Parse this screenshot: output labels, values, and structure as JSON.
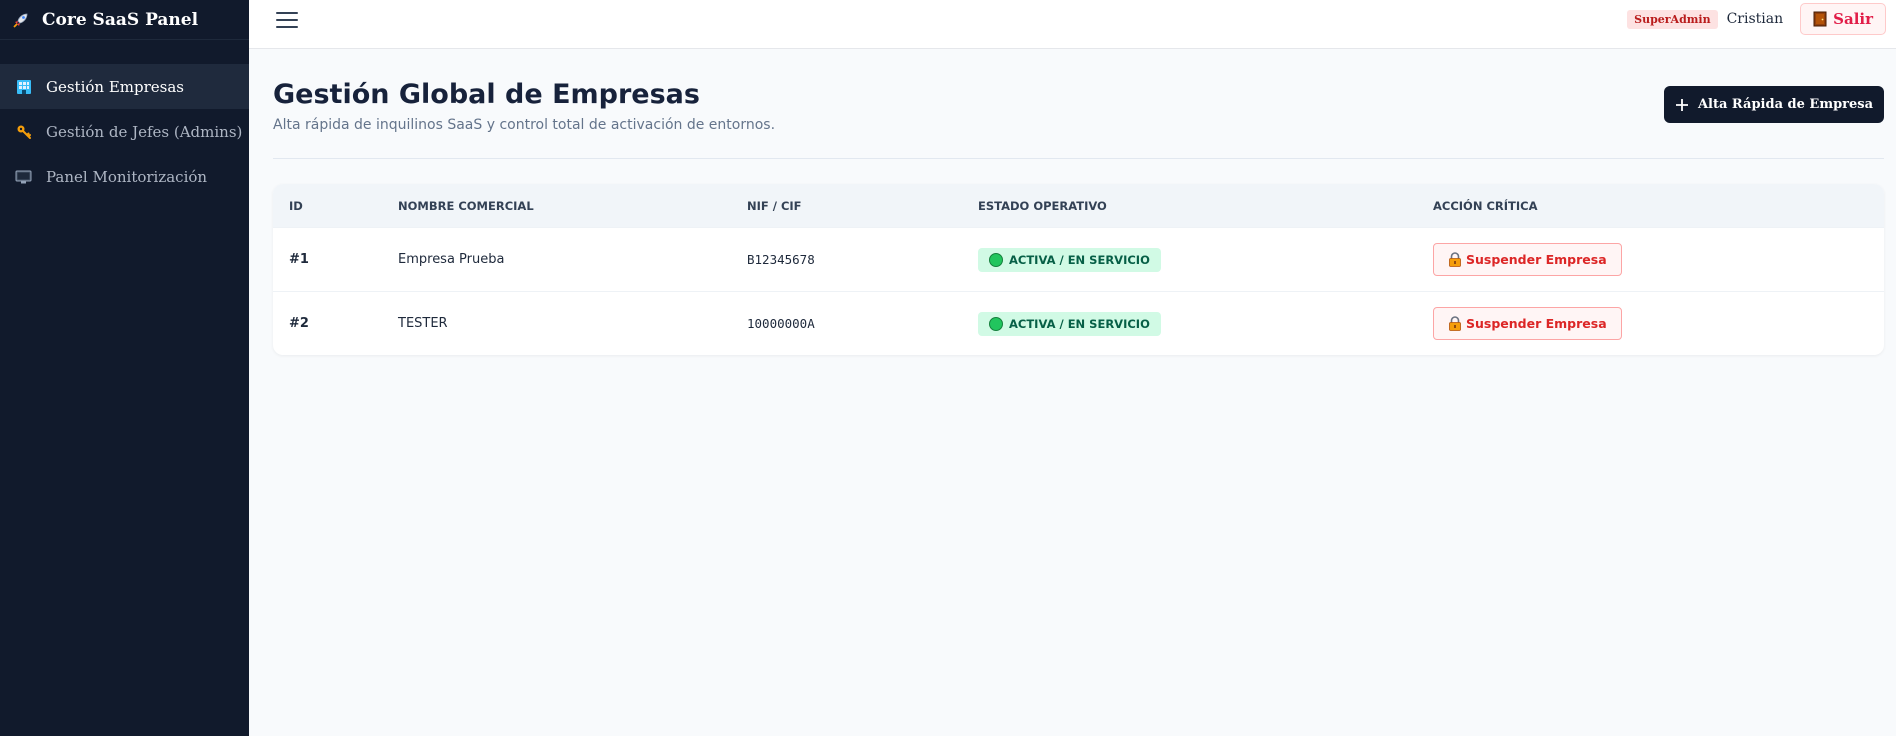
{
  "app": {
    "title": "Core SaaS Panel",
    "icon": "rocket-icon"
  },
  "sidebar": {
    "items": [
      {
        "label": "Gestión Empresas",
        "icon": "building-icon",
        "active": true
      },
      {
        "label": "Gestión de Jefes (Admins)",
        "icon": "key-icon",
        "active": false
      },
      {
        "label": "Panel Monitorización",
        "icon": "monitor-icon",
        "active": false
      }
    ]
  },
  "topbar": {
    "menu_icon": "hamburger-icon",
    "role_badge": "SuperAdmin",
    "username": "Cristian",
    "logout_label": "Salir",
    "logout_icon": "door-icon"
  },
  "page": {
    "title": "Gestión Global de Empresas",
    "subtitle": "Alta rápida de inquilinos SaaS y control total de activación de entornos.",
    "primary_action": "Alta Rápida de Empresa",
    "primary_action_icon": "plus-icon"
  },
  "table": {
    "columns": [
      "ID",
      "NOMBRE COMERCIAL",
      "NIF / CIF",
      "ESTADO OPERATIVO",
      "ACCIÓN CRÍTICA"
    ],
    "rows": [
      {
        "id": "#1",
        "name": "Empresa Prueba",
        "nif": "B12345678",
        "status": "ACTIVA / EN SERVICIO",
        "action": "Suspender Empresa"
      },
      {
        "id": "#2",
        "name": "TESTER",
        "nif": "10000000A",
        "status": "ACTIVA / EN SERVICIO",
        "action": "Suspender Empresa"
      }
    ]
  },
  "colors": {
    "sidebar_bg": "#111a2c",
    "accent_danger": "#dc2626",
    "status_ok": "#22c55e",
    "primary_btn": "#111a2c"
  }
}
